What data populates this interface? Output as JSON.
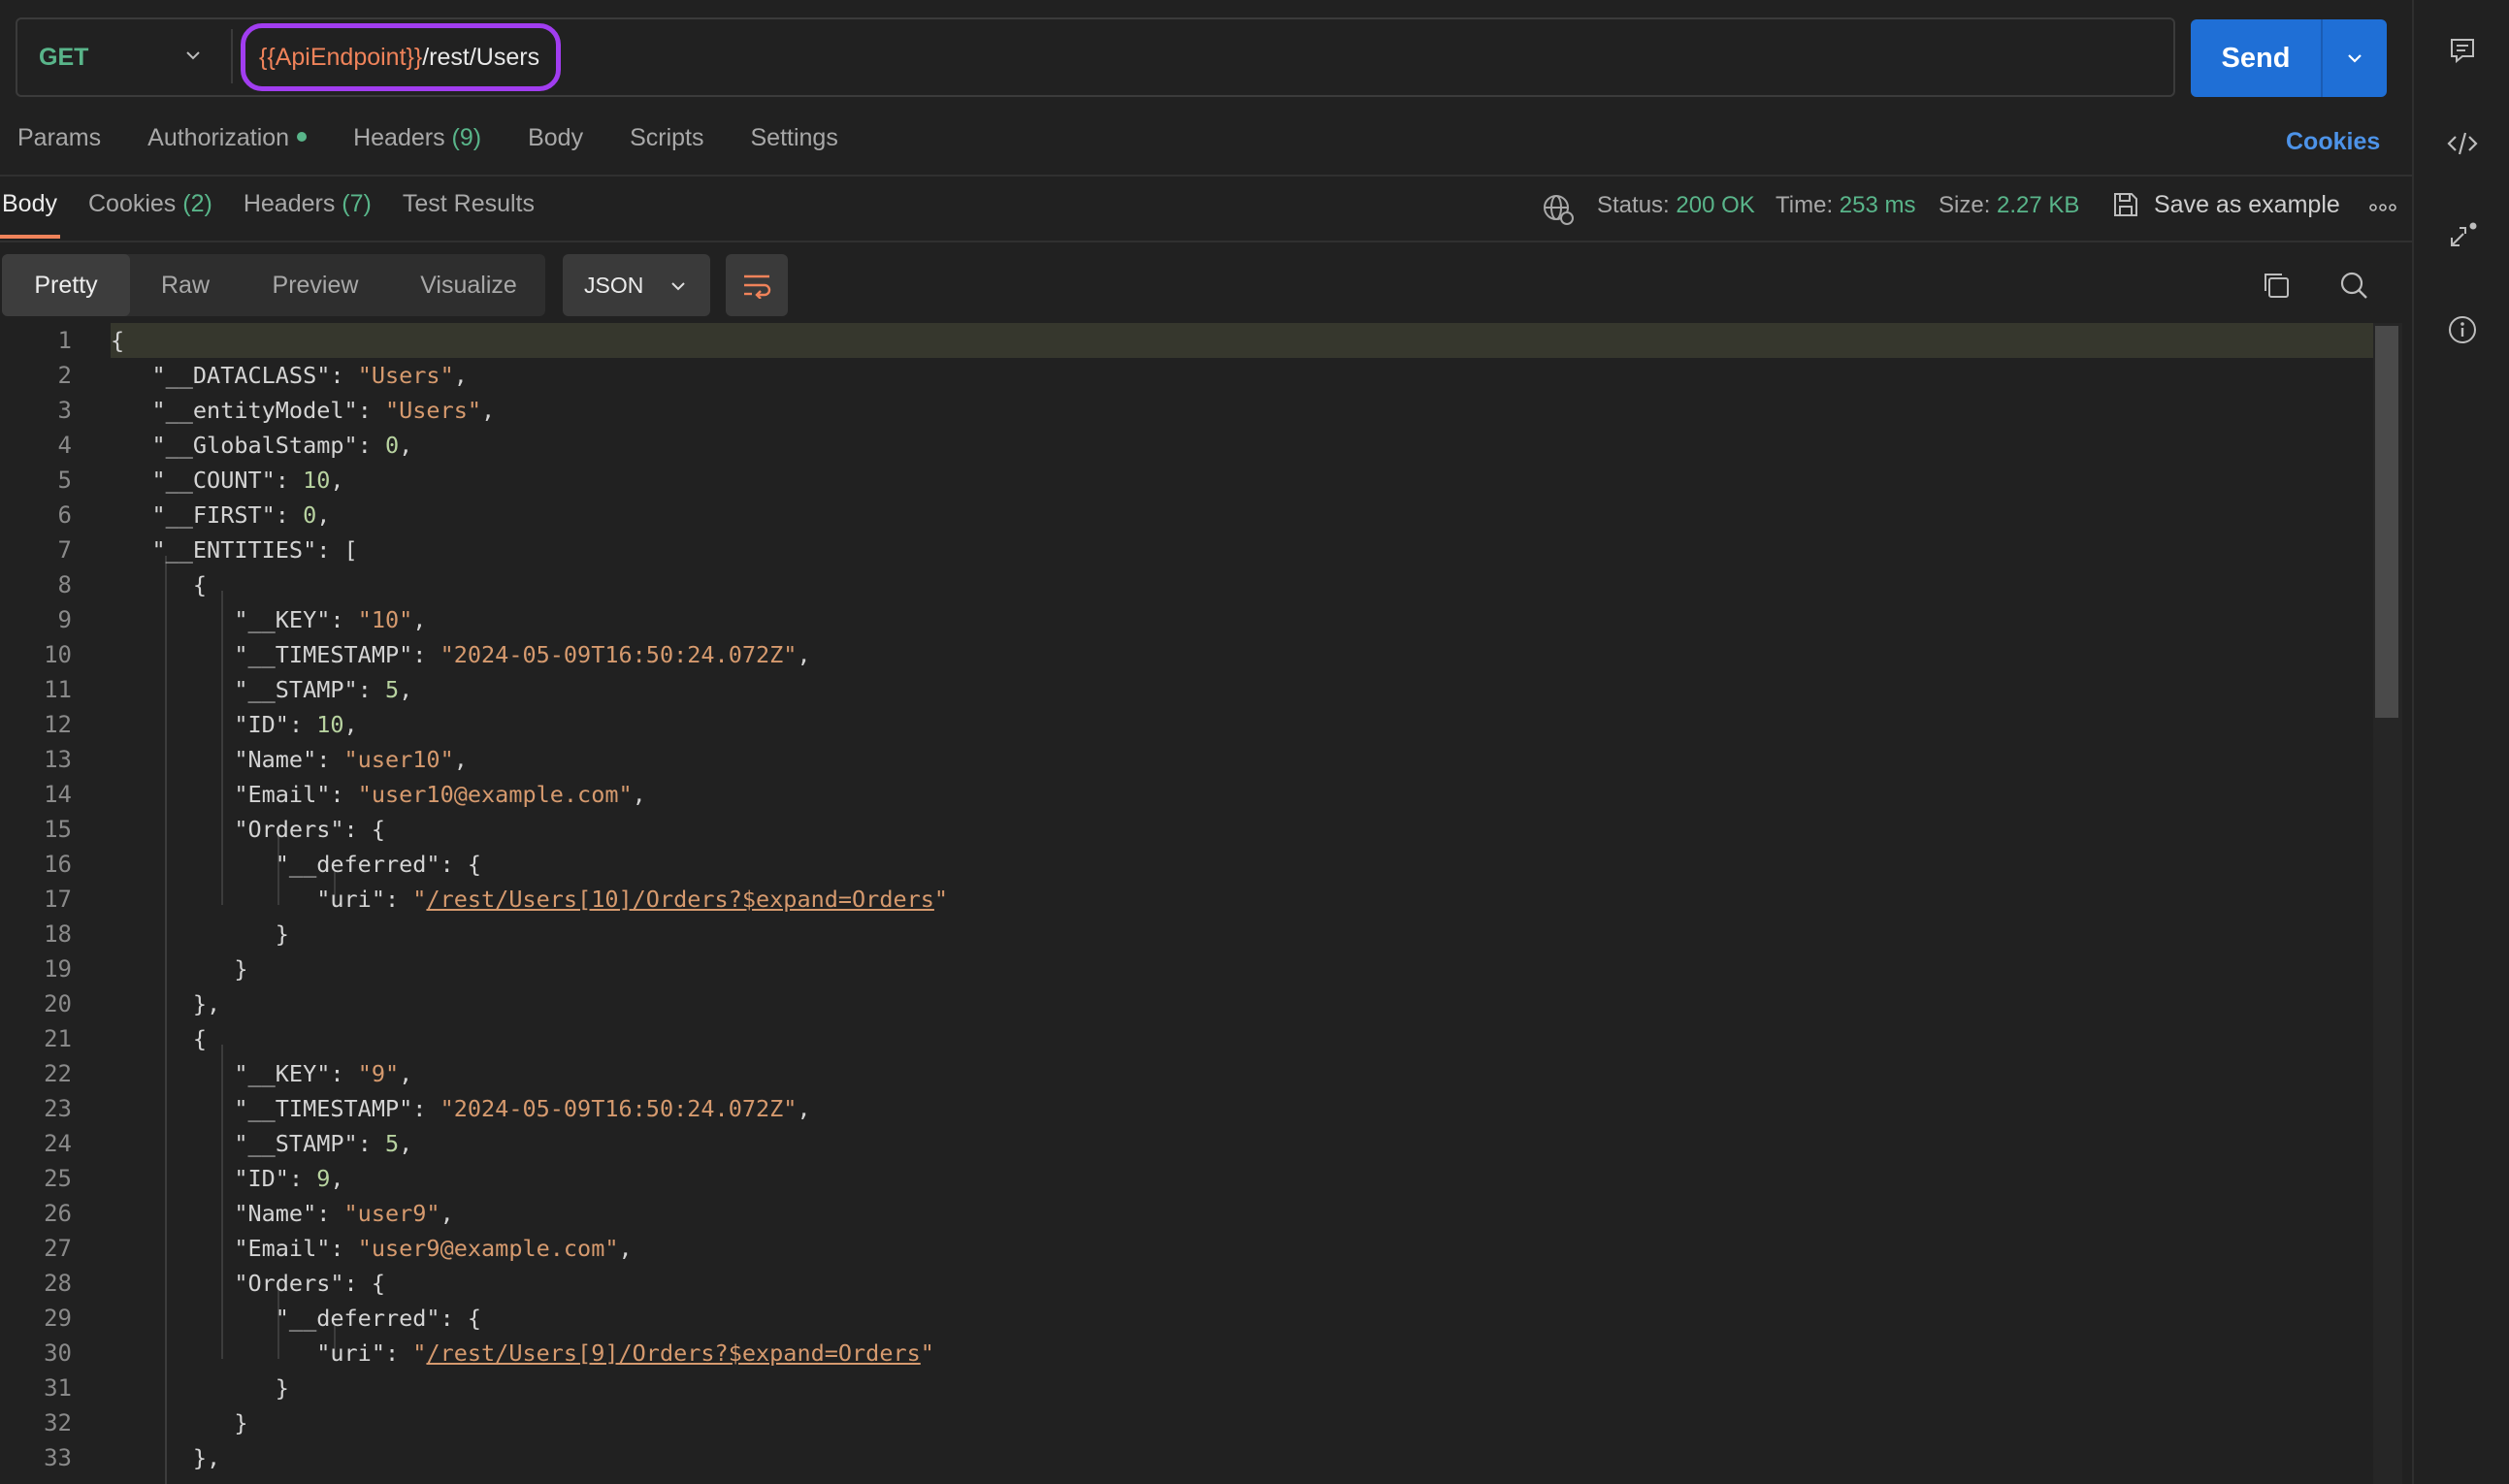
{
  "request": {
    "method": "GET",
    "url_var": "{{ApiEndpoint}}",
    "url_path": "/rest/Users",
    "send_label": "Send"
  },
  "request_tabs": {
    "params": "Params",
    "authorization": "Authorization",
    "headers": "Headers",
    "headers_count": "(9)",
    "body": "Body",
    "scripts": "Scripts",
    "settings": "Settings",
    "cookies": "Cookies"
  },
  "response_tabs": {
    "body": "Body",
    "cookies": "Cookies",
    "cookies_count": "(2)",
    "headers": "Headers",
    "headers_count": "(7)",
    "test_results": "Test Results"
  },
  "response_meta": {
    "status_label": "Status:",
    "status_value": "200 OK",
    "time_label": "Time:",
    "time_value": "253 ms",
    "size_label": "Size:",
    "size_value": "2.27 KB",
    "save_example": "Save as example"
  },
  "view_modes": {
    "pretty": "Pretty",
    "raw": "Raw",
    "preview": "Preview",
    "visualize": "Visualize",
    "format": "JSON"
  },
  "code_lines": [
    {
      "n": "1"
    },
    {
      "n": "2"
    },
    {
      "n": "3"
    },
    {
      "n": "4"
    },
    {
      "n": "5"
    },
    {
      "n": "6"
    },
    {
      "n": "7"
    },
    {
      "n": "8"
    },
    {
      "n": "9"
    },
    {
      "n": "10"
    },
    {
      "n": "11"
    },
    {
      "n": "12"
    },
    {
      "n": "13"
    },
    {
      "n": "14"
    },
    {
      "n": "15"
    },
    {
      "n": "16"
    },
    {
      "n": "17"
    },
    {
      "n": "18"
    },
    {
      "n": "19"
    },
    {
      "n": "20"
    },
    {
      "n": "21"
    },
    {
      "n": "22"
    },
    {
      "n": "23"
    },
    {
      "n": "24"
    },
    {
      "n": "25"
    },
    {
      "n": "26"
    },
    {
      "n": "27"
    },
    {
      "n": "28"
    },
    {
      "n": "29"
    },
    {
      "n": "30"
    },
    {
      "n": "31"
    },
    {
      "n": "32"
    },
    {
      "n": "33"
    }
  ],
  "json_body": {
    "dataclass_key": "\"__DATACLASS\"",
    "dataclass_val": "\"Users\"",
    "entitymodel_key": "\"__entityModel\"",
    "entitymodel_val": "\"Users\"",
    "globalstamp_key": "\"__GlobalStamp\"",
    "globalstamp_val": "0",
    "count_key": "\"__COUNT\"",
    "count_val": "10",
    "first_key": "\"__FIRST\"",
    "first_val": "0",
    "entities_key": "\"__ENTITIES\"",
    "key_key": "\"__KEY\"",
    "timestamp_key": "\"__TIMESTAMP\"",
    "stamp_key": "\"__STAMP\"",
    "id_key": "\"ID\"",
    "name_key": "\"Name\"",
    "email_key": "\"Email\"",
    "orders_key": "\"Orders\"",
    "deferred_key": "\"__deferred\"",
    "uri_key": "\"uri\"",
    "e1_key": "\"10\"",
    "e1_timestamp": "\"2024-05-09T16:50:24.072Z\"",
    "e1_stamp": "5",
    "e1_id": "10",
    "e1_name": "\"user10\"",
    "e1_email": "\"user10@example.com\"",
    "e1_uri": "/rest/Users[10]/Orders?$expand=Orders",
    "e2_key": "\"9\"",
    "e2_timestamp": "\"2024-05-09T16:50:24.072Z\"",
    "e2_stamp": "5",
    "e2_id": "9",
    "e2_name": "\"user9\"",
    "e2_email": "\"user9@example.com\"",
    "e2_uri": "/rest/Users[9]/Orders?$expand=Orders"
  },
  "icons": {
    "method_dropdown": "chevron-down-icon",
    "send_dropdown": "chevron-down-icon",
    "network": "globe-network-icon",
    "save": "floppy-disk-icon",
    "more": "more-horizontal-icon",
    "wrap": "word-wrap-icon",
    "copy": "copy-icon",
    "search": "search-icon",
    "comments": "comment-icon",
    "code": "code-icon",
    "related": "related-requests-icon",
    "info": "info-icon"
  }
}
